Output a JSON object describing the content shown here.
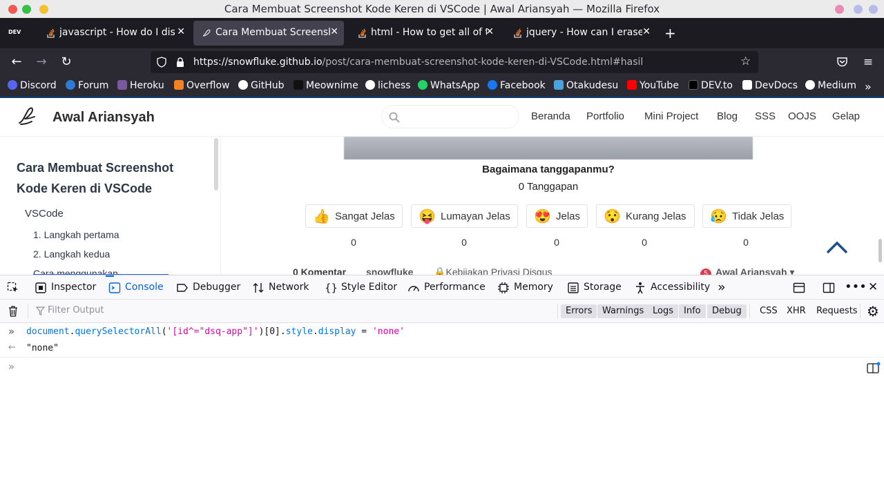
{
  "window": {
    "title": "Cara Membuat Screenshot Kode Keren di VSCode | Awal Ariansyah — Mozilla Firefox"
  },
  "tabs": [
    {
      "label": "javascript - How do I disat",
      "icon": "stackoverflow-icon"
    },
    {
      "label": "Cara Membuat Screensho",
      "icon": "site-icon",
      "active": true
    },
    {
      "label": "html - How to get all of th",
      "icon": "stackoverflow-icon"
    },
    {
      "label": "jquery - How can I erase a",
      "icon": "stackoverflow-icon"
    }
  ],
  "navbar": {
    "url_host": "https://snowfluke.github.io",
    "url_path": "/post/cara-membuat-screenshot-kode-keren-di-VSCode.html#hasil"
  },
  "bookmarks": [
    {
      "label": "Discord",
      "color": "#5865f2"
    },
    {
      "label": "Forum",
      "color": "#2d7bd6"
    },
    {
      "label": "Heroku",
      "color": "#79589f"
    },
    {
      "label": "Overflow",
      "color": "#f48024"
    },
    {
      "label": "GitHub",
      "color": "#ffffff"
    },
    {
      "label": "Meownime",
      "color": "#222222"
    },
    {
      "label": "lichess",
      "color": "#ffffff"
    },
    {
      "label": "WhatsApp",
      "color": "#25d366"
    },
    {
      "label": "Facebook",
      "color": "#1877f2"
    },
    {
      "label": "Otakudesu",
      "color": "#4aa3df"
    },
    {
      "label": "YouTube",
      "color": "#ff0000"
    },
    {
      "label": "DEV.to",
      "color": "#000000"
    },
    {
      "label": "DevDocs",
      "color": "#ffffff"
    },
    {
      "label": "Medium",
      "color": "#000000"
    }
  ],
  "site": {
    "name": "Awal Ariansyah",
    "menu": [
      "Beranda",
      "Portfolio",
      "Mini Project",
      "Blog",
      "SSS",
      "OOJS",
      "Gelap"
    ]
  },
  "sidebar": {
    "title": "Cara Membuat Screenshot Kode Keren di VSCode",
    "toc": [
      "VSCode",
      "1. Langkah pertama",
      "2. Langkah kedua",
      "Cara menggunakan"
    ]
  },
  "main": {
    "question": "Bagaimana tanggapanmu?",
    "responses": "0 Tanggapan",
    "reactions": [
      {
        "label": "Sangat Jelas",
        "emoji": "👍",
        "count": "0"
      },
      {
        "label": "Lumayan Jelas",
        "emoji": "😝",
        "count": "0"
      },
      {
        "label": "Jelas",
        "emoji": "😍",
        "count": "0"
      },
      {
        "label": "Kurang Jelas",
        "emoji": "😯",
        "count": "0"
      },
      {
        "label": "Tidak Jelas",
        "emoji": "😥",
        "count": "0"
      }
    ],
    "disqus": {
      "comments": "0 Komentar",
      "site": "snowfluke",
      "privacy": "Kebijakan Privasi Disqus",
      "user_badge": "5",
      "user": "Awal Ariansyah"
    }
  },
  "devtools": {
    "tabs": [
      "Inspector",
      "Console",
      "Debugger",
      "Network",
      "Style Editor",
      "Performance",
      "Memory",
      "Storage",
      "Accessibility"
    ],
    "active_tab": "Console",
    "filter_placeholder": "Filter Output",
    "levels": [
      "Errors",
      "Warnings",
      "Logs",
      "Info",
      "Debug"
    ],
    "types": [
      "CSS",
      "XHR",
      "Requests"
    ],
    "console": {
      "input_obj": "document",
      "input_method": "querySelectorAll",
      "input_arg": "'[id^=\"dsq-app\"]'",
      "input_index": "[0]",
      "input_prop1": "style",
      "input_prop2": "display",
      "input_value": "'none'",
      "output": "\"none\""
    }
  }
}
